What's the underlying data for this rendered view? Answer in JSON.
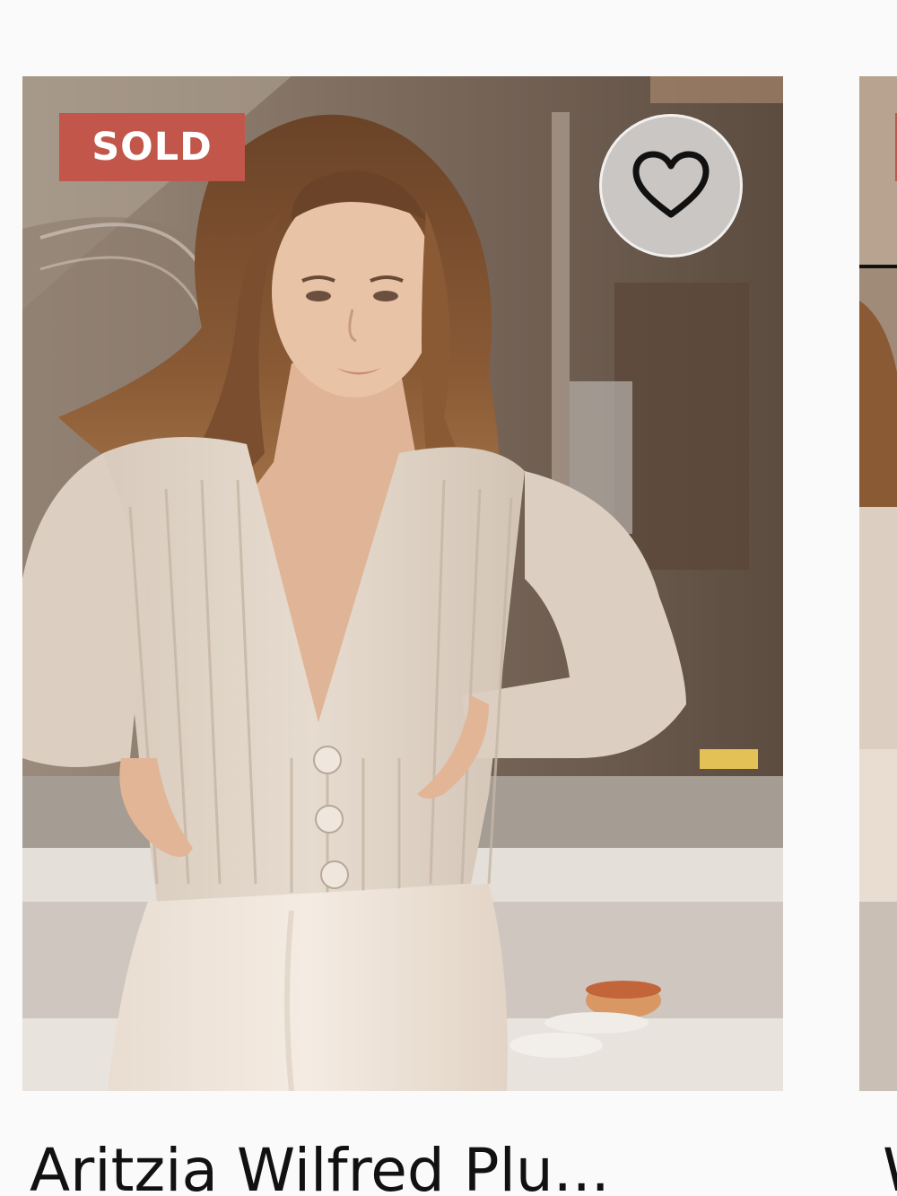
{
  "listing": {
    "badge": "SOLD",
    "title": "Aritzia Wilfred Plu...",
    "like_icon": "heart-outline-icon"
  },
  "next_listing": {
    "title_fragment": "W"
  },
  "colors": {
    "badge_background": "#c2564a",
    "badge_text": "#ffffff",
    "like_button_background": "#c9c6c3",
    "title_text": "#111111",
    "page_background": "#fbfafa"
  }
}
